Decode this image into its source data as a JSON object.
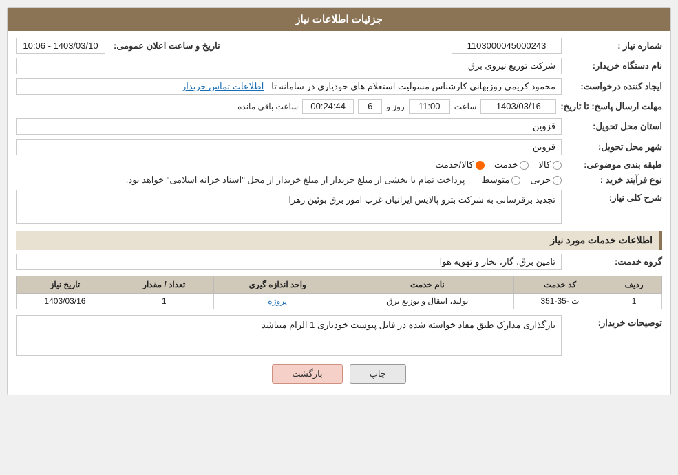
{
  "page": {
    "title": "جزئیات اطلاعات نیاز",
    "header": {
      "label": "جزئیات اطلاعات نیاز"
    },
    "fields": {
      "shomara_niaz_label": "شماره نیاز :",
      "shomara_niaz_value": "1103000045000243",
      "nam_dastgah_label": "نام دستگاه خریدار:",
      "nam_dastgah_value": "شرکت توزیع نیروی برق",
      "ijad_konande_label": "ایجاد کننده درخواست:",
      "ijad_konande_value": "محمود کریمی روزبهانی کارشناس  مسولیت استعلام های خودیاری در سامانه تا",
      "etelaaat_tamas_label": "اطلاعات تماس خریدار",
      "mohlat_label": "مهلت ارسال پاسخ: تا تاریخ:",
      "mohlat_date": "1403/03/16",
      "mohlat_time_label": "ساعت",
      "mohlat_time": "11:00",
      "mohlat_roz_label": "روز و",
      "mohlat_roz": "6",
      "mohlat_remaining_label": "ساعت باقی مانده",
      "mohlat_remaining": "00:24:44",
      "ostan_label": "استان محل تحویل:",
      "ostan_value": "قزوین",
      "shahr_label": "شهر محل تحویل:",
      "shahr_value": "قزوین",
      "tabaghebandi_label": "طبقه بندی موضوعی:",
      "kala_label": "کالا",
      "khadamat_label": "خدمت",
      "kala_khadamat_label": "کالا/خدمت",
      "kala_selected": false,
      "khadamat_selected": false,
      "kala_khadamat_selected": true,
      "nogh_farayand_label": "نوع فرآیند خرید :",
      "jozee_label": "جزیی",
      "motavaset_label": "متوسط",
      "pardakht_text": "پرداخت تمام یا بخشی از مبلغ خریدار از مبلغ خریدار از محل \"اسناد خزانه اسلامی\" خواهد بود.",
      "sharh_niaz_section": "شرح کلی نیاز:",
      "sharh_niaz_value": "تجدید برقرسانی به شرکت بترو پالایش ایرانیان غرب امور برق بوئین زهرا",
      "khadamat_section": "اطلاعات خدمات مورد نیاز",
      "gorooh_label": "گروه خدمت:",
      "gorooh_value": "تامین برق، گاز، بخار و تهویه هوا",
      "table": {
        "headers": [
          "ردیف",
          "کد خدمت",
          "نام خدمت",
          "واحد اندازه گیری",
          "تعداد / مقدار",
          "تاریخ نیاز"
        ],
        "rows": [
          {
            "radif": "1",
            "code": "ت -35-351",
            "name": "تولید، انتقال و توزیع برق",
            "unit": "پروژه",
            "count": "1",
            "date": "1403/03/16"
          }
        ]
      },
      "buyer_desc_label": "توصیحات خریدار:",
      "buyer_desc_value": "بارگذاری مدارک طبق مفاد خواسته شده در فایل پیوست خودیاری 1 الزام میباشد",
      "btn_print": "چاپ",
      "btn_back": "بازگشت",
      "tarikh_elan_label": "تاریخ و ساعت اعلان عمومی:",
      "tarikh_elan_value": "1403/03/10 - 10:06"
    }
  }
}
